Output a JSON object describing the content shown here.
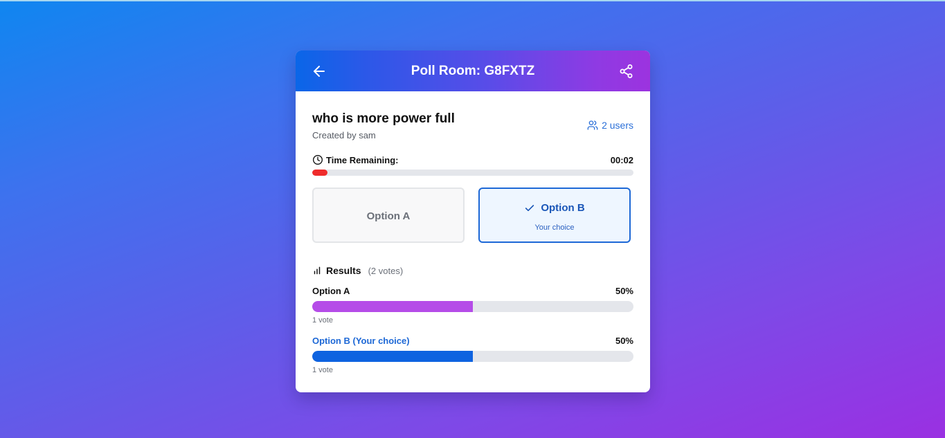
{
  "header": {
    "title": "Poll Room: G8FXTZ",
    "back_icon": "arrow-left-icon",
    "share_icon": "share-icon"
  },
  "poll": {
    "question": "who is more power full",
    "created_by": "Created by sam",
    "users": "2 users"
  },
  "timer": {
    "label": "Time Remaining:",
    "value": "00:02",
    "fraction_remaining": 0.047,
    "color": "#ef2b2b"
  },
  "options": [
    {
      "label": "Option A",
      "selected": false
    },
    {
      "label": "Option B",
      "selected": true,
      "sublabel": "Your choice"
    }
  ],
  "results": {
    "title": "Results",
    "total": "(2 votes)",
    "items": [
      {
        "label": "Option A",
        "percent_text": "50%",
        "percent": 50,
        "votes": "1 vote",
        "color": "#b54ce8",
        "label_color": "#111111"
      },
      {
        "label": "Option B (Your choice)",
        "percent_text": "50%",
        "percent": 50,
        "votes": "1 vote",
        "color": "#0e63e0",
        "label_color": "#1d68d6"
      }
    ]
  },
  "colors": {
    "accent": "#1d68d6",
    "background_start": "#0f86f0",
    "background_end": "#9a30e2"
  }
}
